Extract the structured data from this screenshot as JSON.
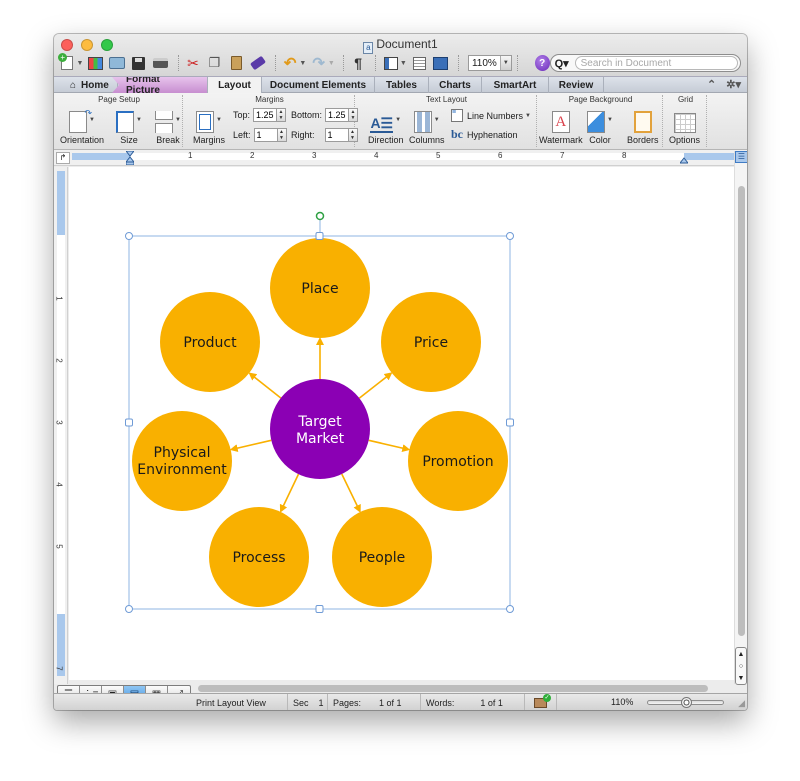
{
  "window": {
    "title": "Document1",
    "traffic_lights": [
      "close",
      "minimize",
      "zoom"
    ]
  },
  "toolbar": {
    "zoom_value": "110%",
    "help_label": "?",
    "search_placeholder": "Search in Document",
    "search_icon_label": "Q▾",
    "buttons": [
      "new-document",
      "gallery",
      "open",
      "save",
      "print",
      "cut",
      "copy",
      "paste",
      "format-painter",
      "undo",
      "redo",
      "show-formatting",
      "sidebar",
      "toolbox",
      "media-browser"
    ]
  },
  "tabs": {
    "home": "Home",
    "format_picture": "Format Picture",
    "layout": "Layout",
    "document_elements": "Document Elements",
    "tables": "Tables",
    "charts": "Charts",
    "smartart": "SmartArt",
    "review": "Review",
    "active": "Layout"
  },
  "ribbon": {
    "page_setup": {
      "title": "Page Setup",
      "orientation": "Orientation",
      "size": "Size",
      "break": "Break"
    },
    "margins": {
      "title": "Margins",
      "margins_button": "Margins",
      "top_label": "Top:",
      "top_value": "1.25",
      "bottom_label": "Bottom:",
      "bottom_value": "1.25",
      "left_label": "Left:",
      "left_value": "1",
      "right_label": "Right:",
      "right_value": "1"
    },
    "text_layout": {
      "title": "Text Layout",
      "direction": "Direction",
      "columns": "Columns",
      "line_numbers": "Line Numbers",
      "hyphenation": "Hyphenation"
    },
    "page_background": {
      "title": "Page Background",
      "watermark": "Watermark",
      "color": "Color",
      "borders": "Borders"
    },
    "grid": {
      "title": "Grid",
      "options": "Options"
    }
  },
  "rulers": {
    "horizontal_numbers": [
      "1",
      "2",
      "3",
      "4",
      "5",
      "6",
      "7",
      "8"
    ],
    "vertical_numbers": [
      "1",
      "2",
      "3",
      "4",
      "5",
      "7"
    ]
  },
  "diagram": {
    "center": {
      "label_line1": "Target",
      "label_line2": "Market",
      "color": "#8b00b4",
      "text_color": "#ffffff"
    },
    "node_color": "#f9b000",
    "arrow_color": "#f9b000",
    "node_text_color": "#1a1a1a",
    "nodes": [
      {
        "id": "place",
        "line1": "Place",
        "line2": ""
      },
      {
        "id": "price",
        "line1": "Price",
        "line2": ""
      },
      {
        "id": "promotion",
        "line1": "Promotion",
        "line2": ""
      },
      {
        "id": "people",
        "line1": "People",
        "line2": ""
      },
      {
        "id": "process",
        "line1": "Process",
        "line2": ""
      },
      {
        "id": "physical-environment",
        "line1": "Physical",
        "line2": "Environment"
      },
      {
        "id": "product",
        "line1": "Product",
        "line2": ""
      }
    ]
  },
  "statusbar": {
    "view_name": "Print Layout View",
    "sec_label": "Sec",
    "sec_value": "1",
    "pages_label": "Pages:",
    "pages_value": "1 of 1",
    "words_label": "Words:",
    "words_value": "1 of 1",
    "zoom_value": "110%",
    "zoom_slider_fraction": 0.5,
    "views": [
      "draft",
      "outline",
      "publishing-layout",
      "print-layout",
      "notebook-layout",
      "full-screen"
    ],
    "active_view": "print-layout"
  }
}
